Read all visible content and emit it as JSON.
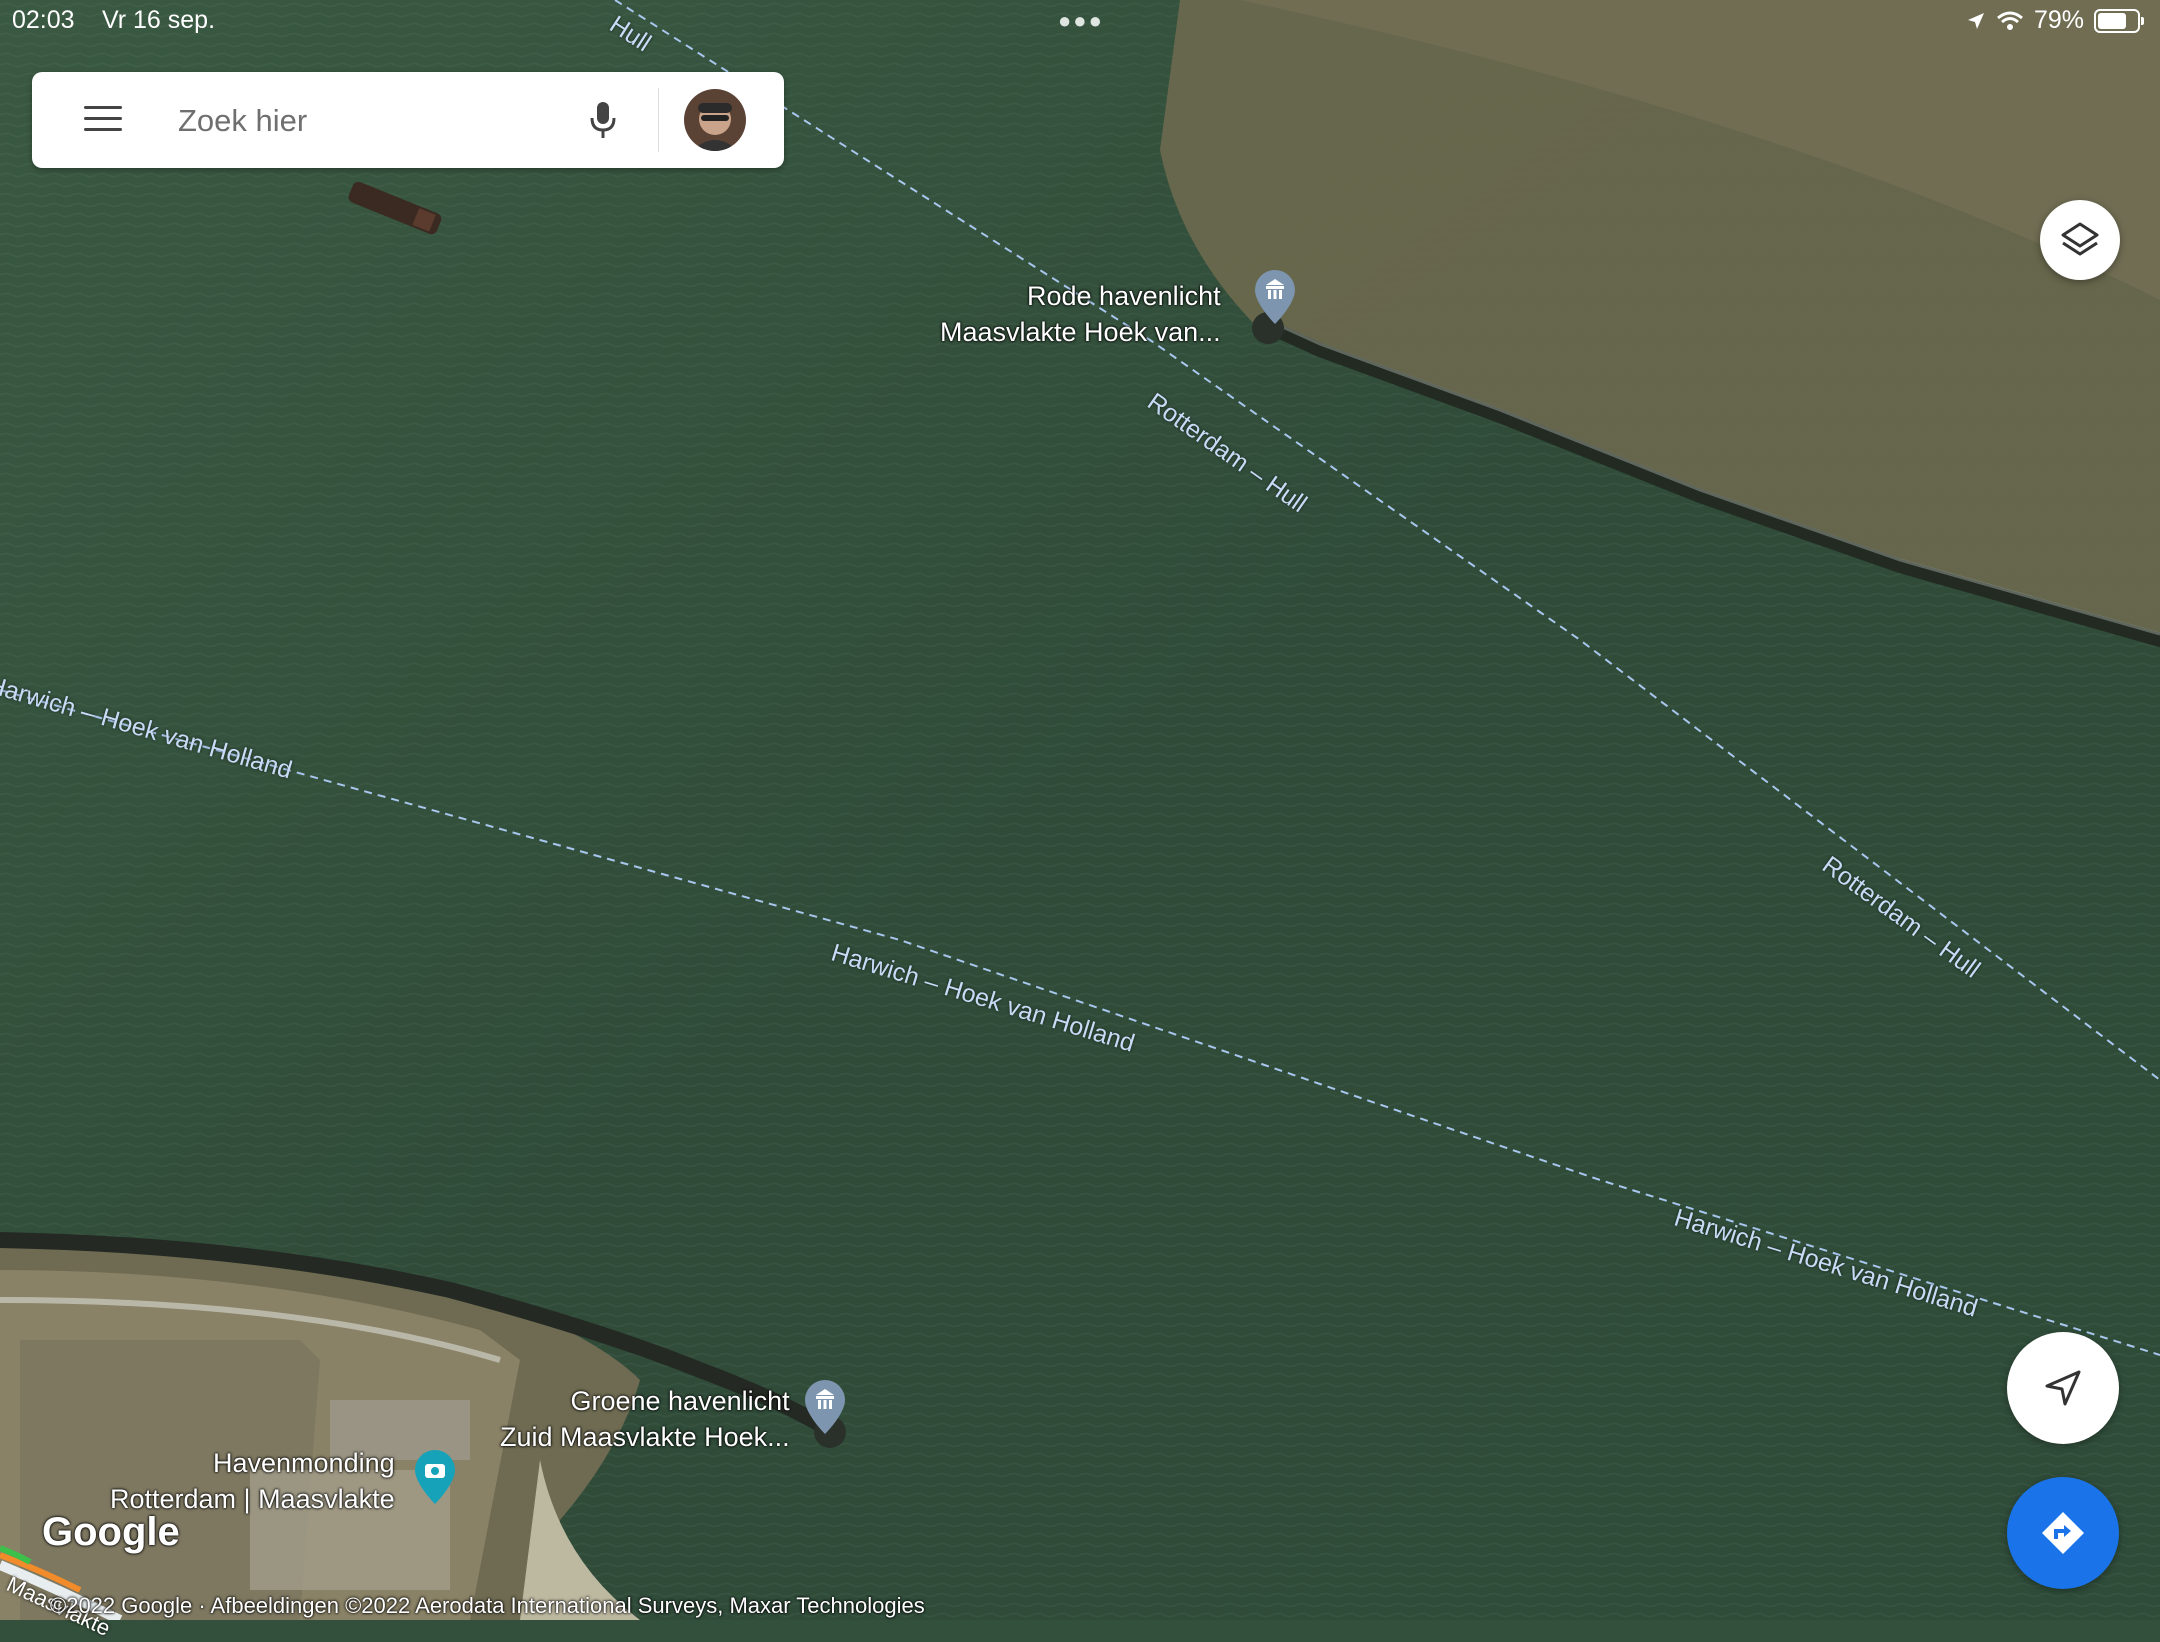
{
  "status_bar": {
    "time": "02:03",
    "date": "Vr 16 sep.",
    "battery": "79%",
    "battery_level": 0.79
  },
  "search": {
    "placeholder": "Zoek hier"
  },
  "routes": {
    "rotterdam_hull": "Rotterdam – Hull",
    "rotterdam_hull_partial": "Hull",
    "harwich_hoek": "Harwich – Hoek van Holland",
    "harwich_hoek_partial": "Harwich – Hoek van Holland"
  },
  "pois": {
    "red_light_line1": "Rode havenlicht",
    "red_light_line2": "Maasvlakte Hoek van...",
    "green_light_line1": "Groene havenlicht",
    "green_light_line2": "Zuid Maasvlakte Hoek...",
    "harbor_line1": "Havenmonding",
    "harbor_line2": "Rotterdam | Maasvlakte"
  },
  "road": "Maasvlakte",
  "logo": "Google",
  "copyright": "©2022 Google · Afbeeldingen ©2022 Aerodata International Surveys, Maxar Technologies",
  "icons": {
    "menu": "menu-icon",
    "mic": "microphone-icon",
    "layers": "layers-icon",
    "locate": "navigation-arrow-icon",
    "directions": "directions-icon",
    "museum": "museum-icon",
    "camera": "camera-icon"
  },
  "colors": {
    "water": "#33503c",
    "water_brown": "#6f6a4f",
    "route_line": "#a9c6ee",
    "directions_blue": "#1a73e8"
  }
}
